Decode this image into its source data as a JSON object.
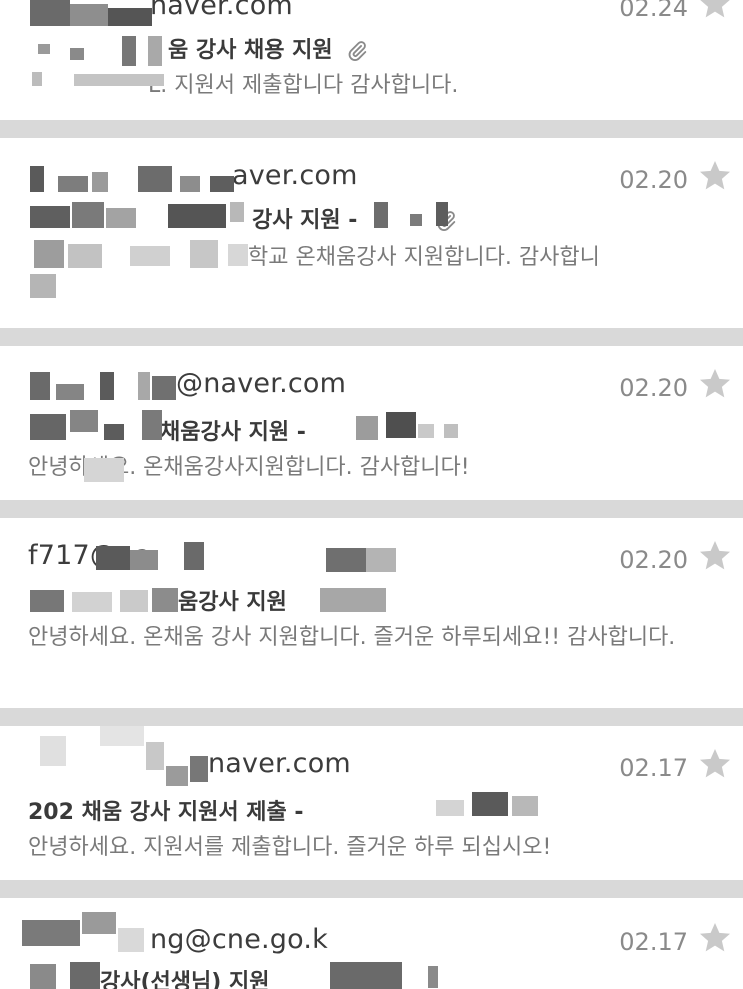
{
  "colors": {
    "background": "#d9d9d9",
    "card": "#ffffff",
    "sender_text": "#3c3c3c",
    "subject_text": "#3a3a3a",
    "snippet_text": "#7a7a7a",
    "date_text": "#8a8a8a",
    "star": "#c9c9c9",
    "redaction_dark": "#555555",
    "redaction_mid": "#9a9a9a",
    "redaction_light": "#d2d2d2"
  },
  "emails": [
    {
      "sender": "naver.com",
      "date": "02.24",
      "subject": "움 강사 채용 지원",
      "has_attachment": true,
      "snippet": "L. 지원서 제출합니다 감사합니다.",
      "starred": false
    },
    {
      "sender": "aver.com",
      "date": "02.20",
      "subject": "강사 지원 -",
      "has_attachment": true,
      "snippet": "학교 온채움강사 지원합니다. 감사합니",
      "starred": false
    },
    {
      "sender": "@naver.com",
      "date": "02.20",
      "subject": "채움강사 지원 -",
      "has_attachment": false,
      "snippet": "안녕하세요. 온채움강사지원합니다. 감사합니다!",
      "starred": false
    },
    {
      "sender": "f717@na",
      "date": "02.20",
      "subject": "움강사 지원",
      "has_attachment": false,
      "snippet": "안녕하세요. 온채움 강사 지원합니다. 즐거운 하루되세요!! 감사합니다.",
      "starred": false
    },
    {
      "sender": "naver.com",
      "date": "02.17",
      "subject": "202 채움 강사 지원서 제출 -",
      "has_attachment": false,
      "snippet": "안녕하세요. 지원서를 제출합니다. 즐거운 하루 되십시오!",
      "starred": false
    },
    {
      "sender": "ng@cne.go.k",
      "date": "02.17",
      "subject": "강사(선생님) 지원",
      "has_attachment": false,
      "snippet": "",
      "starred": false
    }
  ]
}
